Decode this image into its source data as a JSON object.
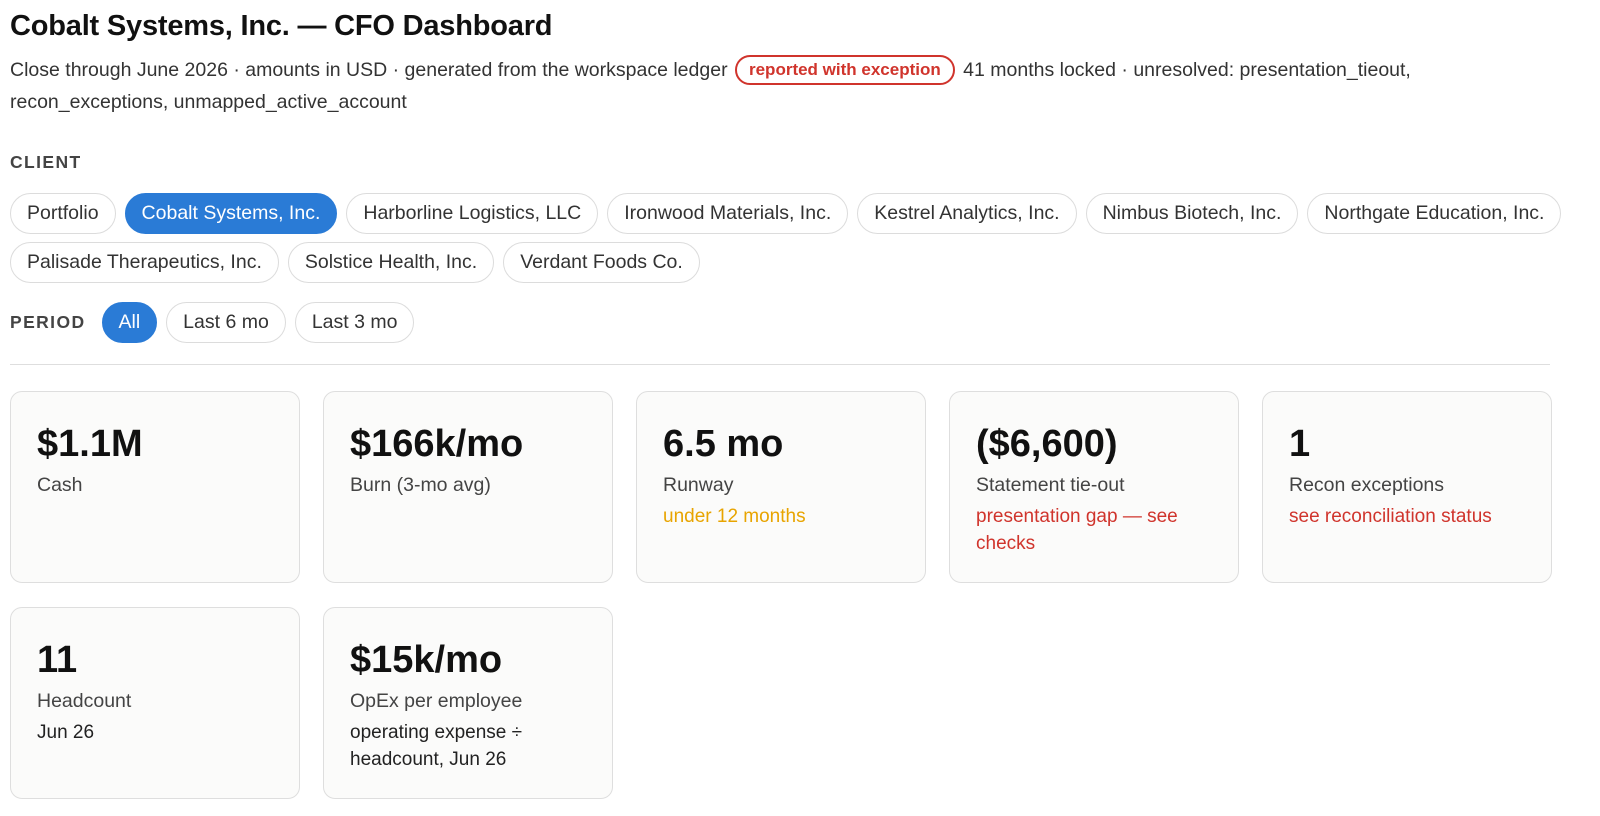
{
  "header": {
    "title": "Cobalt Systems, Inc. — CFO Dashboard",
    "subtitle_before": "Close through June 2026 · amounts in USD · generated from the workspace ledger",
    "badge": "reported with exception",
    "subtitle_after": "41 months locked · unresolved: presentation_tieout, recon_exceptions, unmapped_active_account"
  },
  "client": {
    "label": "CLIENT",
    "selected": "Cobalt Systems, Inc.",
    "options": [
      "Portfolio",
      "Cobalt Systems, Inc.",
      "Harborline Logistics, LLC",
      "Ironwood Materials, Inc.",
      "Kestrel Analytics, Inc.",
      "Nimbus Biotech, Inc.",
      "Northgate Education, Inc.",
      "Palisade Therapeutics, Inc.",
      "Solstice Health, Inc.",
      "Verdant Foods Co."
    ]
  },
  "period": {
    "label": "PERIOD",
    "selected": "All",
    "options": [
      "All",
      "Last 6 mo",
      "Last 3 mo"
    ]
  },
  "kpis": [
    {
      "value": "$1.1M",
      "label": "Cash",
      "note": "",
      "tone": ""
    },
    {
      "value": "$166k/mo",
      "label": "Burn (3-mo avg)",
      "note": "",
      "tone": ""
    },
    {
      "value": "6.5 mo",
      "label": "Runway",
      "note": "under 12 months",
      "tone": "warn"
    },
    {
      "value": "($6,600)",
      "label": "Statement tie-out",
      "note": "presentation gap — see checks",
      "tone": "danger"
    },
    {
      "value": "1",
      "label": "Recon exceptions",
      "note": "see reconciliation status",
      "tone": "danger"
    },
    {
      "value": "11",
      "label": "Headcount",
      "note": "Jun 26",
      "tone": ""
    },
    {
      "value": "$15k/mo",
      "label": "OpEx per employee",
      "note": "operating expense ÷ headcount, Jun 26",
      "tone": ""
    }
  ],
  "colors": {
    "accent": "#2a7bd6",
    "danger": "#d0342c",
    "warn": "#e8a400"
  }
}
